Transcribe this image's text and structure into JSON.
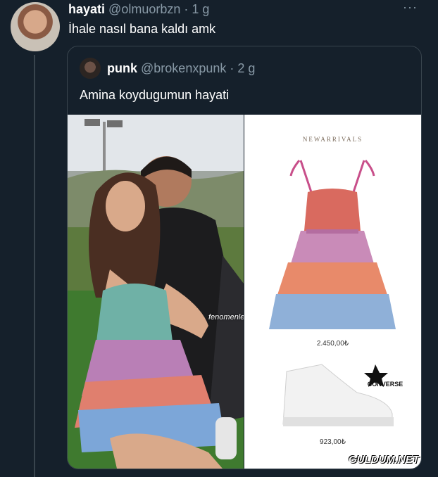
{
  "tweet": {
    "name": "hayati",
    "handle": "@olmuorbzn",
    "time": "· 1 g",
    "more": "···",
    "text": "İhale nasıl bana kaldı amk"
  },
  "quote": {
    "name": "punk",
    "handle": "@brokenxpunk",
    "time": "· 2 g",
    "text": "Amina koydugumun hayati"
  },
  "media": {
    "photo_watermark": "fenomenlernegiymis",
    "new_arrivals": "NEWARRIVALS",
    "dress_price": "2.450,00₺",
    "brand": "CONVERSE",
    "shoe_price": "923,00₺"
  },
  "site_mark": "GULDUM.NET",
  "colors": {
    "background": "#15202b",
    "border": "#38444d",
    "muted_text": "#8899a6"
  }
}
